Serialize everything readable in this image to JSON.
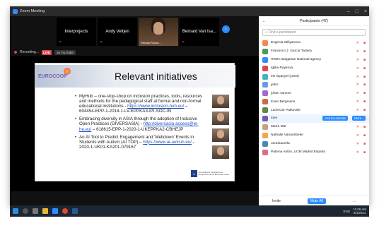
{
  "window": {
    "title": "Zoom Meeting"
  },
  "video_strip": {
    "tiles": [
      {
        "label": "Interprojects",
        "photo": false
      },
      {
        "label": "Andy Veltjen",
        "photo": false
      },
      {
        "label": "Renata Rzovà...",
        "photo": true
      },
      {
        "label": "Bernard Van Isa...",
        "photo": false
      }
    ]
  },
  "recording": {
    "label": "Recording...",
    "live": "LIVE",
    "platform": "on YouTube"
  },
  "slide": {
    "logo": "EUROCOOP",
    "title": "Relevant initiatives",
    "bullets": [
      {
        "text": "MyHub – one-stop-shop on inclusion practices, tools, resources and methods for the pedagogical staff at formal and non-formal educational institutions - ",
        "link": "https://www.inclusion-hub.eu/",
        "tail": " – 604454-EPP-1-2018-1-LV-EPPKA3-IPI-SOC-IN"
      },
      {
        "text": "Embracing diversity in ASIA through the adoption of Inclusive Open Practices (DIVERSASIA) - ",
        "link": "http://diversasia-access@le-he.eu/",
        "tail": " – 618615-EPP-1-2020-1-UKEPPKA2-CBHEJP"
      },
      {
        "text": "An AI Tool to Predict Engagement and 'Meltdown' Events in Students with Autism (AI TOP) – ",
        "link": "https://www.ai-autism.eu/",
        "tail": " - 2020-1-UK01-KA201-079167"
      }
    ],
    "eu_text": "Co-funded by the Erasmus+ Programme of the European Union"
  },
  "participants": {
    "header": "Participants (47)",
    "search_placeholder": "Find a participant",
    "list": [
      {
        "name": "Evgenia Stiliyanova",
        "color": "#f08a4b",
        "hl": false
      },
      {
        "name": "Francisco J. García Tartera",
        "color": "#4a9a5c",
        "hl": false
      },
      {
        "name": "HRDC Bulgarian National agency",
        "color": "#2d8cff",
        "hl": false
      },
      {
        "name": "Iglika Raykova",
        "color": "#e0454b",
        "hl": false
      },
      {
        "name": "Iris Śpaeyel (USO)",
        "color": "#4ab0c1",
        "hl": false
      },
      {
        "name": "jelloc",
        "color": "#6a9ae0",
        "hl": false
      },
      {
        "name": "johan vannes",
        "color": "#a06ad0",
        "hl": false
      },
      {
        "name": "Koen Bergmans",
        "color": "#d06a4b",
        "hl": false
      },
      {
        "name": "Lachezar Patkovski",
        "color": "#5c8a4a",
        "hl": false
      },
      {
        "name": "Ioes",
        "color": "#7a5ab0",
        "hl": true
      },
      {
        "name": "María Mar",
        "color": "#c9a07d",
        "hl": false
      },
      {
        "name": "Nathalie Vanrumbeke",
        "color": "#f0a84b",
        "hl": false
      },
      {
        "name": "ouraniaurela",
        "color": "#4a8ab0",
        "hl": false
      },
      {
        "name": "Paloma Antón, UCM Madrid España",
        "color": "#e06a8a",
        "hl": false
      }
    ],
    "ask_unmute": "Ask to Unmute",
    "more": "More ›",
    "footer": {
      "invite": "Invite",
      "mute_all": "Mute All",
      "more": "..."
    }
  },
  "taskbar": {
    "lang": "ENG",
    "time": "11:06 AM",
    "date": "6/4/2021"
  }
}
